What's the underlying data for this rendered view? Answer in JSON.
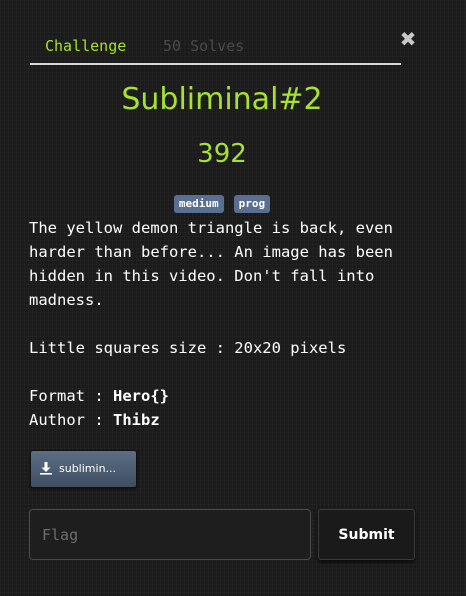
{
  "tabs": {
    "challenge_label": "Challenge",
    "solves_label": "50 Solves"
  },
  "close_glyph": "✖",
  "challenge": {
    "title": "Subliminal#2",
    "points": "392",
    "tags": [
      "medium",
      "prog"
    ],
    "description_lines": [
      "The yellow demon triangle is back, even",
      "harder than before... An image has been",
      "hidden in this video. Don't fall into",
      "madness."
    ],
    "squares_note": "Little squares size : 20x20 pixels",
    "format_label": "Format : ",
    "format_value": "Hero{}",
    "author_label": "Author : ",
    "author_value": "Thibz"
  },
  "file": {
    "label": "sublimin...",
    "icon": "download-icon"
  },
  "flag": {
    "value": "",
    "placeholder": "Flag"
  },
  "submit_label": "Submit",
  "colors": {
    "accent": "#a6e22e",
    "tag_bg": "#5a6f8f",
    "file_button": "#4e5e73"
  }
}
